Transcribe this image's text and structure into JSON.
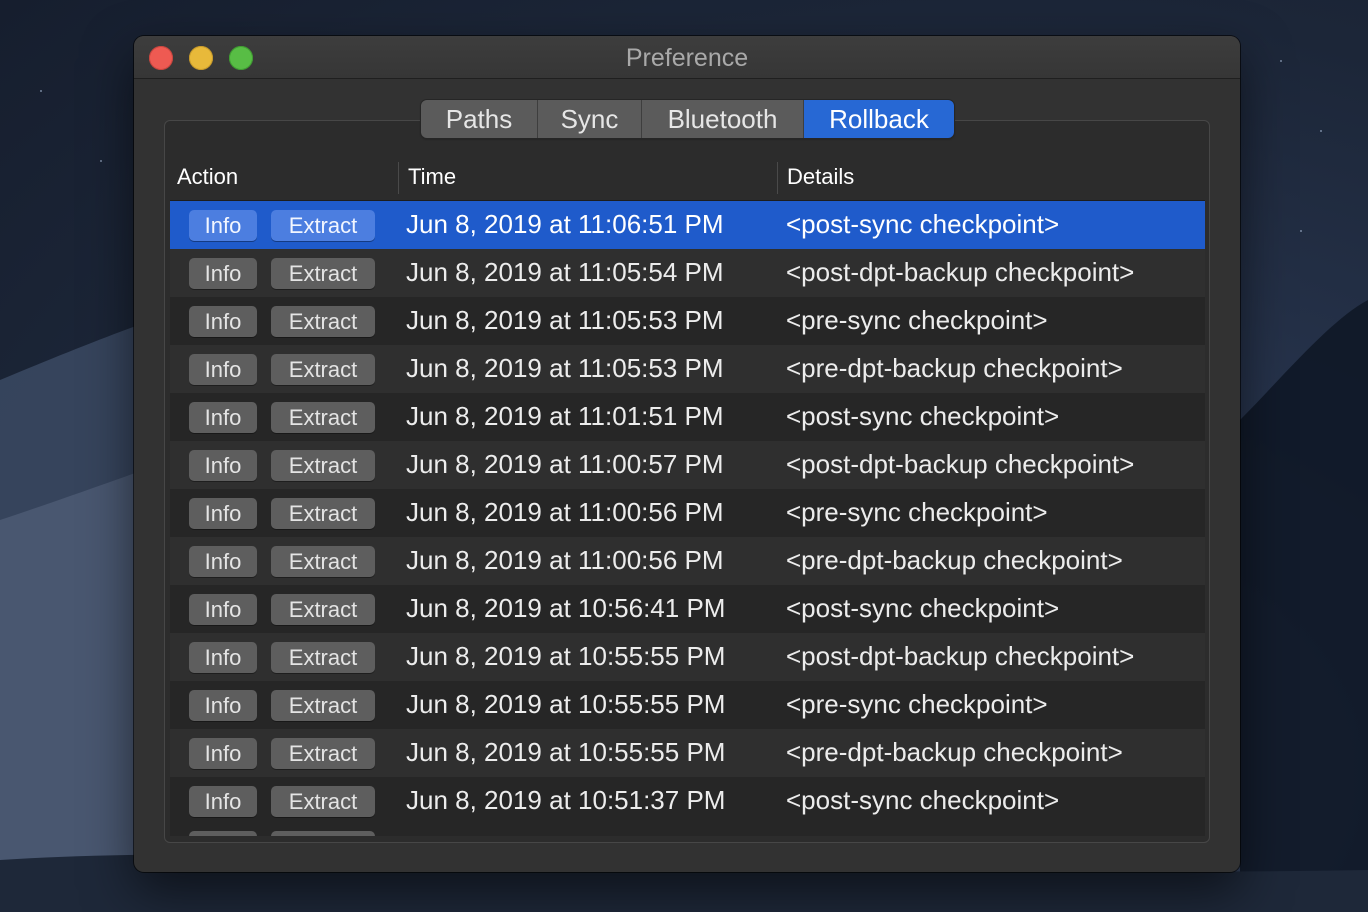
{
  "window": {
    "title": "Preference"
  },
  "tabs": [
    {
      "label": "Paths",
      "active": false
    },
    {
      "label": "Sync",
      "active": false
    },
    {
      "label": "Bluetooth",
      "active": false
    },
    {
      "label": "Rollback",
      "active": true
    }
  ],
  "table": {
    "columns": [
      "Action",
      "Time",
      "Details"
    ],
    "info_label": "Info",
    "extract_label": "Extract",
    "selected_row": 0,
    "rows": [
      {
        "time": "Jun 8, 2019 at 11:06:51 PM",
        "details": "<post-sync checkpoint>"
      },
      {
        "time": "Jun 8, 2019 at 11:05:54 PM",
        "details": "<post-dpt-backup checkpoint>"
      },
      {
        "time": "Jun 8, 2019 at 11:05:53 PM",
        "details": "<pre-sync checkpoint>"
      },
      {
        "time": "Jun 8, 2019 at 11:05:53 PM",
        "details": "<pre-dpt-backup checkpoint>"
      },
      {
        "time": "Jun 8, 2019 at 11:01:51 PM",
        "details": "<post-sync checkpoint>"
      },
      {
        "time": "Jun 8, 2019 at 11:00:57 PM",
        "details": "<post-dpt-backup checkpoint>"
      },
      {
        "time": "Jun 8, 2019 at 11:00:56 PM",
        "details": "<pre-sync checkpoint>"
      },
      {
        "time": "Jun 8, 2019 at 11:00:56 PM",
        "details": "<pre-dpt-backup checkpoint>"
      },
      {
        "time": "Jun 8, 2019 at 10:56:41 PM",
        "details": "<post-sync checkpoint>"
      },
      {
        "time": "Jun 8, 2019 at 10:55:55 PM",
        "details": "<post-dpt-backup checkpoint>"
      },
      {
        "time": "Jun 8, 2019 at 10:55:55 PM",
        "details": "<pre-sync checkpoint>"
      },
      {
        "time": "Jun 8, 2019 at 10:55:55 PM",
        "details": "<pre-dpt-backup checkpoint>"
      },
      {
        "time": "Jun 8, 2019 at 10:51:37 PM",
        "details": "<post-sync checkpoint>"
      }
    ]
  },
  "colors": {
    "accent": "#2768d4",
    "selected_row": "#1f5bcb",
    "window_bg": "#323232",
    "close": "#ee5a52",
    "minimize": "#e8b93a",
    "maximize": "#58bd45"
  }
}
